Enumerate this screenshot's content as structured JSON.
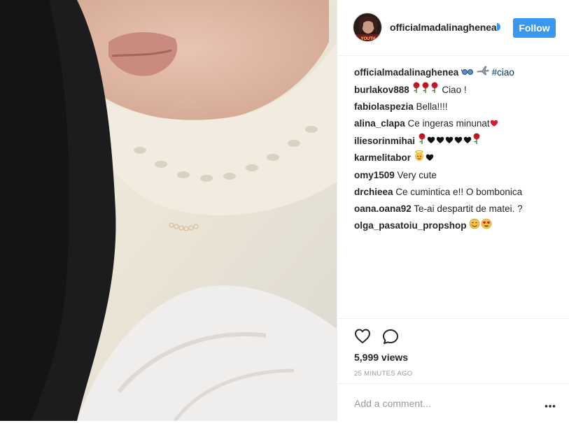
{
  "post": {
    "username": "officialmadalinaghenea",
    "follow_label": "Follow",
    "avatar_text": "YOUTH",
    "views": "5,999 views",
    "time": "25 MINUTES AGO",
    "add_comment_placeholder": "Add a comment...",
    "caption": {
      "user": "officialmadalinaghenea",
      "hashtag": "#ciao"
    },
    "comments": [
      {
        "user": "burlakov888",
        "text": " Ciao !",
        "emoji_before": [
          "rose",
          "rose",
          "rose"
        ],
        "emoji_after": []
      },
      {
        "user": "fabiolaspezia",
        "text": " Bella!!!!",
        "emoji_before": [],
        "emoji_after": []
      },
      {
        "user": "alina_clapa",
        "text": " Ce ingeras minunat",
        "emoji_before": [],
        "emoji_after": [
          "red-heart"
        ]
      },
      {
        "user": "iliesorinmihai",
        "text": " ",
        "emoji_before": [],
        "emoji_after": [
          "rose",
          "black-heart",
          "black-heart",
          "black-heart",
          "black-heart",
          "black-heart",
          "rose"
        ]
      },
      {
        "user": "karmelitabor",
        "text": " ",
        "emoji_before": [],
        "emoji_after": [
          "baby-angel",
          "black-heart"
        ]
      },
      {
        "user": "omy1509",
        "text": " Very cute",
        "emoji_before": [],
        "emoji_after": []
      },
      {
        "user": "drchieea",
        "text": " Ce cumintica e!! O bombonica",
        "emoji_before": [],
        "emoji_after": []
      },
      {
        "user": "oana.oana92",
        "text": " Te-ai despartit de matei. ?",
        "emoji_before": [],
        "emoji_after": []
      },
      {
        "user": "olga_pasatoiu_propshop",
        "text": " ",
        "emoji_before": [],
        "emoji_after": [
          "smiling-face",
          "heart-eyes-face"
        ]
      }
    ]
  },
  "colors": {
    "accent": "#3897f0",
    "hashtag": "#003569",
    "muted": "#999999",
    "text": "#262626",
    "border": "#efefef"
  },
  "icons": {
    "like": "heart-outline-icon",
    "comment": "speech-bubble-icon",
    "more": "more-options-icon",
    "caption_emoji": [
      "glasses-icon",
      "airplane-icon"
    ]
  }
}
